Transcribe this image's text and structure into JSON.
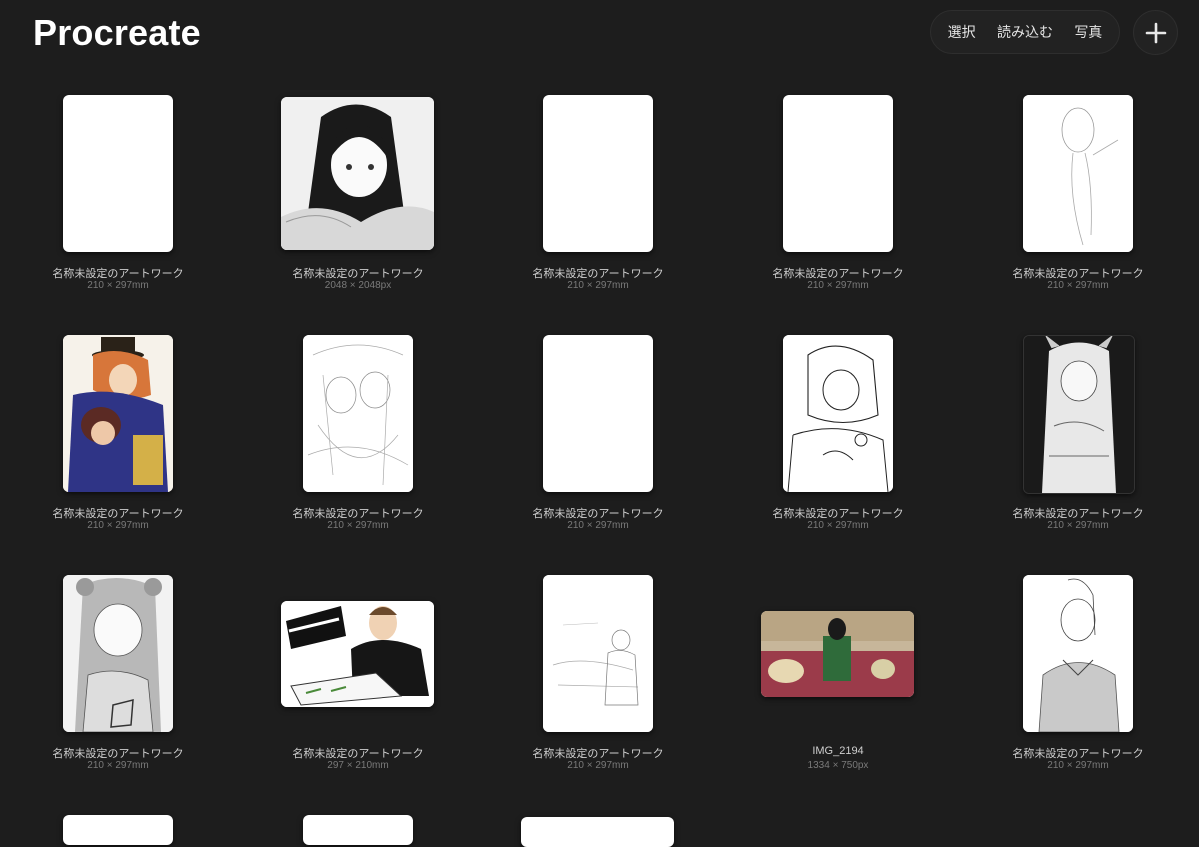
{
  "app_title": "Procreate",
  "toolbar": {
    "select_label": "選択",
    "import_label": "読み込む",
    "photo_label": "写真"
  },
  "gallery": {
    "items": [
      {
        "title": "名称未設定のアートワーク",
        "size": "210 × 297mm",
        "thumb": "blank"
      },
      {
        "title": "名称未設定のアートワーク",
        "size": "2048 × 2048px",
        "thumb": "sketch-girl-dark-hair"
      },
      {
        "title": "名称未設定のアートワーク",
        "size": "210 × 297mm",
        "thumb": "blank"
      },
      {
        "title": "名称未設定のアートワーク",
        "size": "210 × 297mm",
        "thumb": "blank"
      },
      {
        "title": "名称未設定のアートワーク",
        "size": "210 × 297mm",
        "thumb": "rough-sketch"
      },
      {
        "title": "名称未設定のアートワーク",
        "size": "210 × 297mm",
        "thumb": "color-illustration"
      },
      {
        "title": "名称未設定のアートワーク",
        "size": "210 × 297mm",
        "thumb": "line-sketch"
      },
      {
        "title": "名称未設定のアートワーク",
        "size": "210 × 297mm",
        "thumb": "blank"
      },
      {
        "title": "名称未設定のアートワーク",
        "size": "210 × 297mm",
        "thumb": "line-sketch"
      },
      {
        "title": "名称未設定のアートワーク",
        "size": "210 × 297mm",
        "thumb": "gray-sketch-dark"
      },
      {
        "title": "名称未設定のアートワーク",
        "size": "210 × 297mm",
        "thumb": "gray-sketch"
      },
      {
        "title": "名称未設定のアートワーク",
        "size": "297 × 210mm",
        "thumb": "manga-landscape"
      },
      {
        "title": "名称未設定のアートワーク",
        "size": "210 × 297mm",
        "thumb": "rough-sketch"
      },
      {
        "title": "IMG_2194",
        "size": "1334 × 750px",
        "thumb": "photo"
      },
      {
        "title": "名称未設定のアートワーク",
        "size": "210 × 297mm",
        "thumb": "line-sketch"
      }
    ]
  }
}
